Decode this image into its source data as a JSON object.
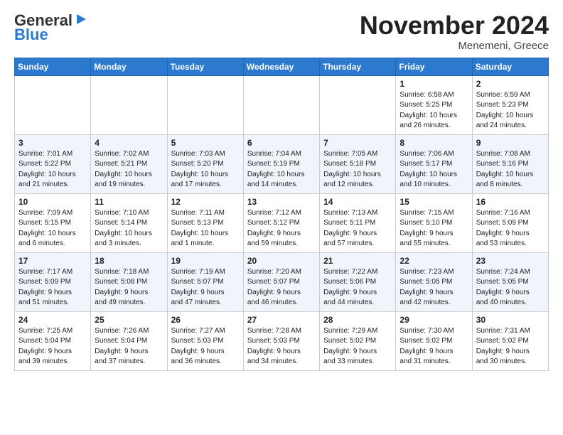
{
  "header": {
    "logo_general": "General",
    "logo_blue": "Blue",
    "month_title": "November 2024",
    "location": "Menemeni, Greece"
  },
  "weekdays": [
    "Sunday",
    "Monday",
    "Tuesday",
    "Wednesday",
    "Thursday",
    "Friday",
    "Saturday"
  ],
  "weeks": [
    [
      {
        "day": "",
        "info": ""
      },
      {
        "day": "",
        "info": ""
      },
      {
        "day": "",
        "info": ""
      },
      {
        "day": "",
        "info": ""
      },
      {
        "day": "",
        "info": ""
      },
      {
        "day": "1",
        "info": "Sunrise: 6:58 AM\nSunset: 5:25 PM\nDaylight: 10 hours\nand 26 minutes."
      },
      {
        "day": "2",
        "info": "Sunrise: 6:59 AM\nSunset: 5:23 PM\nDaylight: 10 hours\nand 24 minutes."
      }
    ],
    [
      {
        "day": "3",
        "info": "Sunrise: 7:01 AM\nSunset: 5:22 PM\nDaylight: 10 hours\nand 21 minutes."
      },
      {
        "day": "4",
        "info": "Sunrise: 7:02 AM\nSunset: 5:21 PM\nDaylight: 10 hours\nand 19 minutes."
      },
      {
        "day": "5",
        "info": "Sunrise: 7:03 AM\nSunset: 5:20 PM\nDaylight: 10 hours\nand 17 minutes."
      },
      {
        "day": "6",
        "info": "Sunrise: 7:04 AM\nSunset: 5:19 PM\nDaylight: 10 hours\nand 14 minutes."
      },
      {
        "day": "7",
        "info": "Sunrise: 7:05 AM\nSunset: 5:18 PM\nDaylight: 10 hours\nand 12 minutes."
      },
      {
        "day": "8",
        "info": "Sunrise: 7:06 AM\nSunset: 5:17 PM\nDaylight: 10 hours\nand 10 minutes."
      },
      {
        "day": "9",
        "info": "Sunrise: 7:08 AM\nSunset: 5:16 PM\nDaylight: 10 hours\nand 8 minutes."
      }
    ],
    [
      {
        "day": "10",
        "info": "Sunrise: 7:09 AM\nSunset: 5:15 PM\nDaylight: 10 hours\nand 6 minutes."
      },
      {
        "day": "11",
        "info": "Sunrise: 7:10 AM\nSunset: 5:14 PM\nDaylight: 10 hours\nand 3 minutes."
      },
      {
        "day": "12",
        "info": "Sunrise: 7:11 AM\nSunset: 5:13 PM\nDaylight: 10 hours\nand 1 minute."
      },
      {
        "day": "13",
        "info": "Sunrise: 7:12 AM\nSunset: 5:12 PM\nDaylight: 9 hours\nand 59 minutes."
      },
      {
        "day": "14",
        "info": "Sunrise: 7:13 AM\nSunset: 5:11 PM\nDaylight: 9 hours\nand 57 minutes."
      },
      {
        "day": "15",
        "info": "Sunrise: 7:15 AM\nSunset: 5:10 PM\nDaylight: 9 hours\nand 55 minutes."
      },
      {
        "day": "16",
        "info": "Sunrise: 7:16 AM\nSunset: 5:09 PM\nDaylight: 9 hours\nand 53 minutes."
      }
    ],
    [
      {
        "day": "17",
        "info": "Sunrise: 7:17 AM\nSunset: 5:09 PM\nDaylight: 9 hours\nand 51 minutes."
      },
      {
        "day": "18",
        "info": "Sunrise: 7:18 AM\nSunset: 5:08 PM\nDaylight: 9 hours\nand 49 minutes."
      },
      {
        "day": "19",
        "info": "Sunrise: 7:19 AM\nSunset: 5:07 PM\nDaylight: 9 hours\nand 47 minutes."
      },
      {
        "day": "20",
        "info": "Sunrise: 7:20 AM\nSunset: 5:07 PM\nDaylight: 9 hours\nand 46 minutes."
      },
      {
        "day": "21",
        "info": "Sunrise: 7:22 AM\nSunset: 5:06 PM\nDaylight: 9 hours\nand 44 minutes."
      },
      {
        "day": "22",
        "info": "Sunrise: 7:23 AM\nSunset: 5:05 PM\nDaylight: 9 hours\nand 42 minutes."
      },
      {
        "day": "23",
        "info": "Sunrise: 7:24 AM\nSunset: 5:05 PM\nDaylight: 9 hours\nand 40 minutes."
      }
    ],
    [
      {
        "day": "24",
        "info": "Sunrise: 7:25 AM\nSunset: 5:04 PM\nDaylight: 9 hours\nand 39 minutes."
      },
      {
        "day": "25",
        "info": "Sunrise: 7:26 AM\nSunset: 5:04 PM\nDaylight: 9 hours\nand 37 minutes."
      },
      {
        "day": "26",
        "info": "Sunrise: 7:27 AM\nSunset: 5:03 PM\nDaylight: 9 hours\nand 36 minutes."
      },
      {
        "day": "27",
        "info": "Sunrise: 7:28 AM\nSunset: 5:03 PM\nDaylight: 9 hours\nand 34 minutes."
      },
      {
        "day": "28",
        "info": "Sunrise: 7:29 AM\nSunset: 5:02 PM\nDaylight: 9 hours\nand 33 minutes."
      },
      {
        "day": "29",
        "info": "Sunrise: 7:30 AM\nSunset: 5:02 PM\nDaylight: 9 hours\nand 31 minutes."
      },
      {
        "day": "30",
        "info": "Sunrise: 7:31 AM\nSunset: 5:02 PM\nDaylight: 9 hours\nand 30 minutes."
      }
    ]
  ]
}
